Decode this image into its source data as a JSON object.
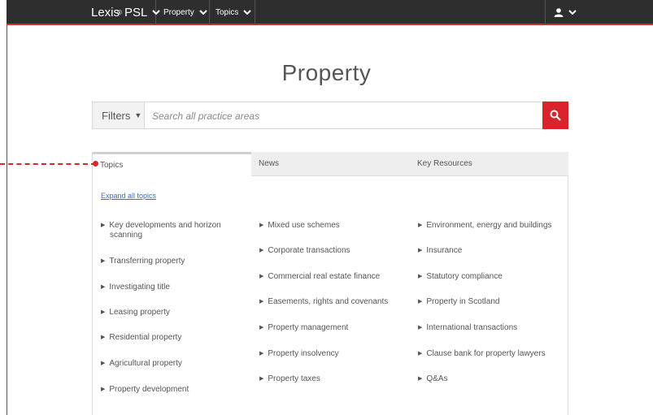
{
  "topbar": {
    "brand": "Lexis",
    "brand_sup": "®",
    "brand_product": "PSL",
    "menu": [
      {
        "label": "Property"
      },
      {
        "label": "Topics"
      }
    ],
    "user_icon": "user-icon"
  },
  "page": {
    "title": "Property"
  },
  "search": {
    "filters_label": "Filters",
    "placeholder": "Search all practice areas",
    "button_icon": "search-icon"
  },
  "tabs": [
    {
      "label": "Topics",
      "active": true
    },
    {
      "label": "News",
      "active": false
    },
    {
      "label": "Key Resources",
      "active": false
    }
  ],
  "expand_label": "Expand all topics",
  "columns": [
    {
      "items": [
        {
          "line1": "Key developments and horizon",
          "line2": "scanning"
        },
        {
          "line1": "Transferring property"
        },
        {
          "line1": "Investigating title"
        },
        {
          "line1": "Leasing property"
        },
        {
          "line1": "Residential property"
        },
        {
          "line1": "Agricultural property"
        },
        {
          "line1": "Property development"
        }
      ]
    },
    {
      "items": [
        {
          "line1": "Mixed use schemes"
        },
        {
          "line1": "Corporate transactions"
        },
        {
          "line1": "Commercial real estate finance"
        },
        {
          "line1": "Easements, rights and covenants"
        },
        {
          "line1": "Property management"
        },
        {
          "line1": "Property insolvency"
        },
        {
          "line1": "Property taxes"
        }
      ]
    },
    {
      "items": [
        {
          "line1": "Environment, energy and buildings"
        },
        {
          "line1": "Insurance"
        },
        {
          "line1": "Statutory compliance"
        },
        {
          "line1": "Property in Scotland"
        },
        {
          "line1": "International transactions"
        },
        {
          "line1": "Clause bank for property lawyers"
        },
        {
          "line1": "Q&As"
        }
      ]
    }
  ],
  "colors": {
    "accent": "#d8232a",
    "topbar": "#2e2e2e",
    "link": "#3a6fc0"
  }
}
